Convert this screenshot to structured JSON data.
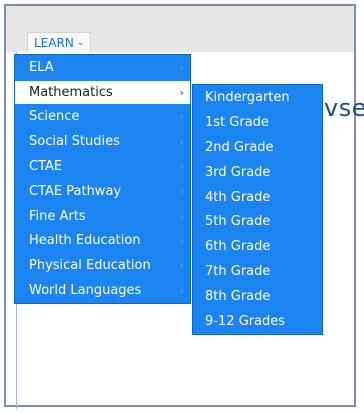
{
  "header": {
    "learn_label": "LEARN",
    "learn_icon": "chevron-down-icon"
  },
  "background_text": "vse",
  "menu": {
    "items": [
      {
        "label": "ELA",
        "arrow": "›"
      },
      {
        "label": "Mathematics",
        "arrow": "›",
        "active": true
      },
      {
        "label": "Science",
        "arrow": "›"
      },
      {
        "label": "Social Studies",
        "arrow": "›"
      },
      {
        "label": "CTAE",
        "arrow": "›"
      },
      {
        "label": "CTAE Pathway",
        "arrow": "›"
      },
      {
        "label": "Fine Arts",
        "arrow": "›"
      },
      {
        "label": "Health Education",
        "arrow": "›"
      },
      {
        "label": "Physical Education",
        "arrow": "›"
      },
      {
        "label": "World Languages",
        "arrow": "›"
      }
    ]
  },
  "submenu": {
    "items": [
      {
        "label": "Kindergarten"
      },
      {
        "label": "1st Grade"
      },
      {
        "label": "2nd Grade"
      },
      {
        "label": "3rd Grade"
      },
      {
        "label": "4th Grade"
      },
      {
        "label": "5th Grade"
      },
      {
        "label": "6th Grade"
      },
      {
        "label": "7th Grade"
      },
      {
        "label": "8th Grade"
      },
      {
        "label": "9-12 Grades"
      }
    ]
  },
  "colors": {
    "menu_bg": "#1b84f1",
    "active_bg": "#ffffff",
    "link_blue": "#1a6fc4",
    "topbar_bg": "#e7e7e7"
  }
}
